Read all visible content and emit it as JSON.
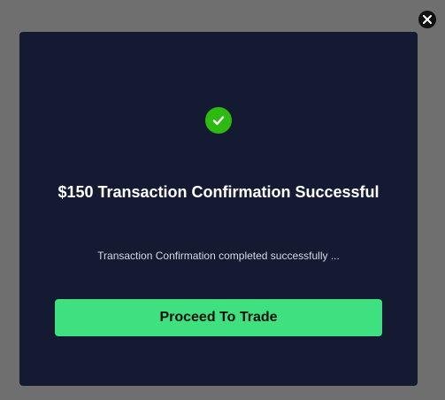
{
  "overlay": {
    "background": "#6f6f6f",
    "close_icon": "close-icon"
  },
  "modal": {
    "background": "#141a31",
    "status_icon": "check-circle-icon",
    "status_color": "#2dbb12",
    "title": "$150 Transaction Confirmation Successful",
    "message": "Transaction Confirmation completed successfully ...",
    "primary_button": {
      "label": "Proceed To Trade",
      "color": "#3fe07f"
    }
  }
}
